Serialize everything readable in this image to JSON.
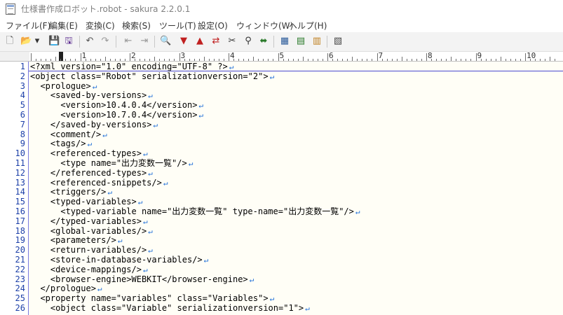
{
  "window": {
    "title": "仕様書作成ロボット.robot - sakura 2.2.0.1"
  },
  "menu": [
    {
      "label": "ファイル(F)"
    },
    {
      "label": "編集(E)"
    },
    {
      "label": "変換(C)"
    },
    {
      "label": "検索(S)"
    },
    {
      "label": "ツール(T)"
    },
    {
      "label": "設定(O)"
    },
    {
      "label": "ウィンドウ(W)"
    },
    {
      "label": "ヘルプ(H)"
    }
  ],
  "toolbar": {
    "buttons": [
      {
        "name": "new-file-icon",
        "glyph": "🗋"
      },
      {
        "name": "open-file-icon",
        "glyph": "📂"
      },
      {
        "name": "open-dropdown-icon",
        "glyph": "▾"
      },
      {
        "name": "save-icon",
        "glyph": "💾"
      },
      {
        "name": "save-all-icon",
        "glyph": "🖫"
      },
      {
        "name": "undo-icon",
        "glyph": "↶"
      },
      {
        "name": "redo-icon",
        "glyph": "↷"
      },
      {
        "name": "jump-back-icon",
        "glyph": "⇤"
      },
      {
        "name": "jump-forward-icon",
        "glyph": "⇥"
      },
      {
        "name": "search-icon",
        "glyph": "🔍"
      },
      {
        "name": "search-next-icon",
        "glyph": "▼"
      },
      {
        "name": "search-prev-icon",
        "glyph": "▲"
      },
      {
        "name": "replace-icon",
        "glyph": "⇄"
      },
      {
        "name": "bookmark-icon",
        "glyph": "✂"
      },
      {
        "name": "grep-icon",
        "glyph": "⚲"
      },
      {
        "name": "tag-jump-icon",
        "glyph": "⬌"
      },
      {
        "name": "compare-icon",
        "glyph": "▦"
      },
      {
        "name": "outline-icon",
        "glyph": "▤"
      },
      {
        "name": "macro-icon",
        "glyph": "▥"
      },
      {
        "name": "settings-icon",
        "glyph": "▧"
      }
    ]
  },
  "ruler": {
    "marks": [
      "1",
      "2",
      "3",
      "4",
      "5",
      "6",
      "7",
      "8",
      "9",
      "10"
    ]
  },
  "editor": {
    "lines": [
      {
        "num": "1",
        "text": "<?xml version=\"1.0\" encoding=\"UTF-8\" ?>"
      },
      {
        "num": "2",
        "text": "<object class=\"Robot\" serializationversion=\"2\">"
      },
      {
        "num": "3",
        "text": "  <prologue>"
      },
      {
        "num": "4",
        "text": "    <saved-by-versions>"
      },
      {
        "num": "5",
        "text": "      <version>10.4.0.4</version>"
      },
      {
        "num": "6",
        "text": "      <version>10.7.0.4</version>"
      },
      {
        "num": "7",
        "text": "    </saved-by-versions>"
      },
      {
        "num": "8",
        "text": "    <comment/>"
      },
      {
        "num": "9",
        "text": "    <tags/>"
      },
      {
        "num": "10",
        "text": "    <referenced-types>"
      },
      {
        "num": "11",
        "text": "      <type name=\"出力変数一覧\"/>"
      },
      {
        "num": "12",
        "text": "    </referenced-types>"
      },
      {
        "num": "13",
        "text": "    <referenced-snippets/>"
      },
      {
        "num": "14",
        "text": "    <triggers/>"
      },
      {
        "num": "15",
        "text": "    <typed-variables>"
      },
      {
        "num": "16",
        "text": "      <typed-variable name=\"出力変数一覧\" type-name=\"出力変数一覧\"/>"
      },
      {
        "num": "17",
        "text": "    </typed-variables>"
      },
      {
        "num": "18",
        "text": "    <global-variables/>"
      },
      {
        "num": "19",
        "text": "    <parameters/>"
      },
      {
        "num": "20",
        "text": "    <return-variables/>"
      },
      {
        "num": "21",
        "text": "    <store-in-database-variables/>"
      },
      {
        "num": "22",
        "text": "    <device-mappings/>"
      },
      {
        "num": "23",
        "text": "    <browser-engine>WEBKIT</browser-engine>"
      },
      {
        "num": "24",
        "text": "  </prologue>"
      },
      {
        "num": "25",
        "text": "  <property name=\"variables\" class=\"Variables\">"
      },
      {
        "num": "26",
        "text": "    <object class=\"Variable\" serializationversion=\"1\">"
      }
    ],
    "eol_glyph": "↵"
  },
  "colors": {
    "editor_bg": "#fffef6",
    "line_number": "#1c3fa8",
    "eol_mark": "#1f6fd8",
    "gutter_border": "#7a7ae0"
  }
}
